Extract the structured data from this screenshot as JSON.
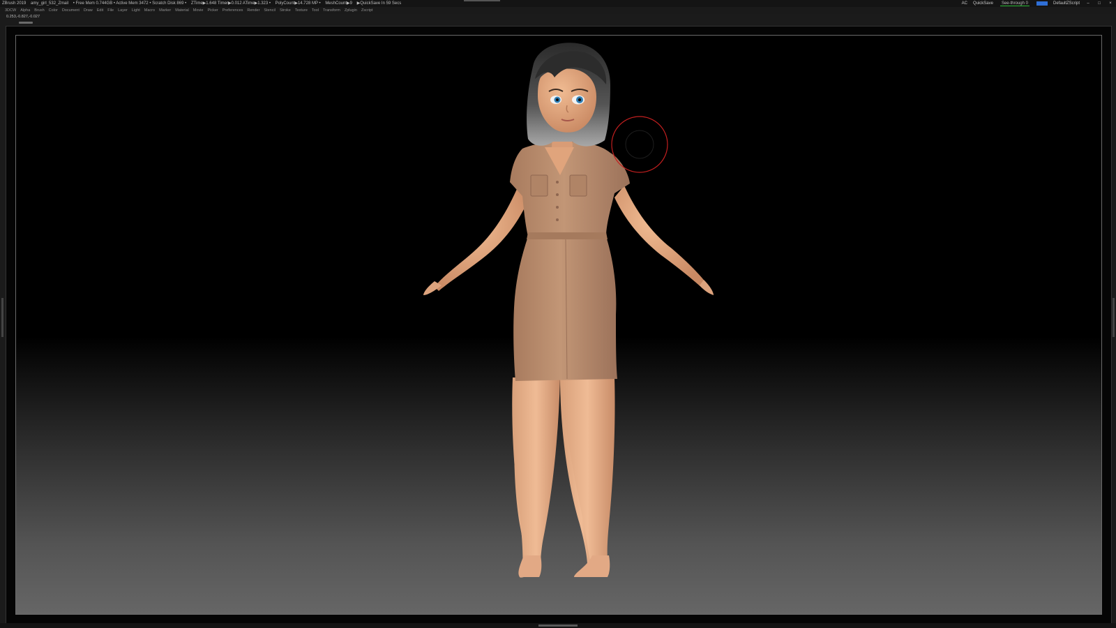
{
  "titlebar": {
    "status": [
      "ZBrush 2019",
      "amy_girl_532_Zmail",
      "• Free Mem 0.744GB • Active Mem 3472 • Scratch Disk 869 •",
      "ZTime▶1.648 Timer▶0.012 ATime▶1.323 •",
      "PolyCount▶14.728 MP •",
      "MeshCount▶9",
      "▶QuickSave In 59 Secs"
    ],
    "ac": "AC",
    "quicksave": "QuickSave",
    "see_through": "See-through 0",
    "script": "DefaultZScript"
  },
  "menu": {
    "items": [
      "3DCW",
      "Alpha",
      "Brush",
      "Color",
      "Document",
      "Draw",
      "Edit",
      "File",
      "Layer",
      "Light",
      "Macro",
      "Marker",
      "Material",
      "Movie",
      "Picker",
      "Preferences",
      "Render",
      "Stencil",
      "Stroke",
      "Texture",
      "Tool",
      "Transform",
      "Zplugin",
      "Zscript"
    ]
  },
  "coords": "0.253,-0.827,-0.027",
  "colors": {
    "accent_green": "#2fbf3a",
    "accent_blue": "#2f6fd6",
    "brush_cursor": "#c21f1f",
    "skin": "#e0a47c",
    "dress": "#b98c6e",
    "hair": "#4a4a4a"
  },
  "icons": [
    "window-minimize-icon",
    "window-restore-icon",
    "window-close-icon"
  ]
}
